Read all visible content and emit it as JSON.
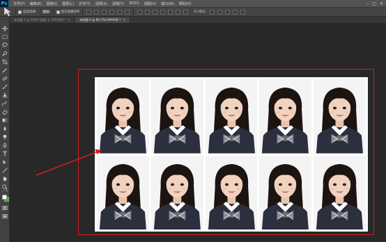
{
  "app": {
    "logo": "Ps"
  },
  "menu": [
    "文件(F)",
    "编辑(E)",
    "图像(I)",
    "图层(L)",
    "文字(Y)",
    "选择(S)",
    "滤镜(T)",
    "3D(D)",
    "视图(V)",
    "窗口(W)",
    "帮助(H)"
  ],
  "window_controls": [
    "–",
    "□",
    "✕"
  ],
  "options": {
    "auto_select_label": "自动选择：",
    "auto_select_value": "图层",
    "show_transform_label": "显示变换控件",
    "mode_3d_label": "3D 模式："
  },
  "tabs": [
    {
      "label": "未标题-1 @ 100% (图层 1, CMYK/8) *",
      "close": "×"
    },
    {
      "label": "未标题-2 @ 66.7%(CMYK/8) *",
      "close": "×"
    }
  ],
  "colors": {
    "foreground": "#ffffff",
    "background": "#2fb52f",
    "highlight": "#d41d1d"
  },
  "photos": {
    "count": 10,
    "rows": 2,
    "columns": 5
  }
}
